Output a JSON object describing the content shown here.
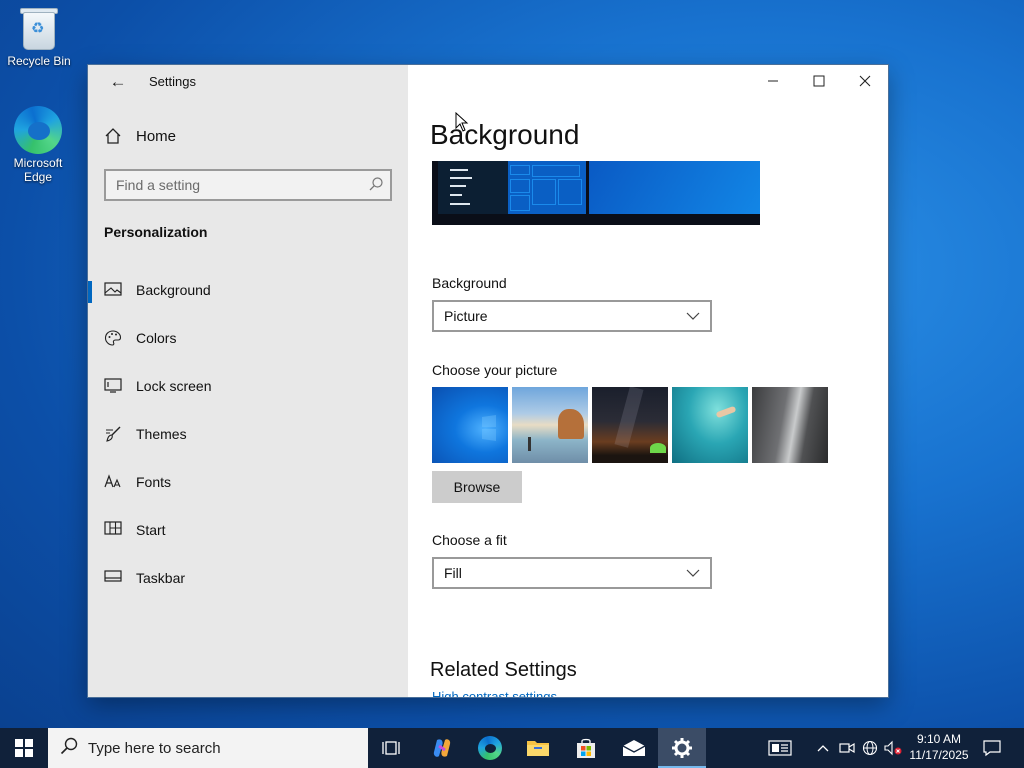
{
  "desktop": {
    "icons": [
      {
        "label": "Recycle Bin"
      },
      {
        "label": "Microsoft Edge"
      }
    ]
  },
  "window": {
    "app_title": "Settings",
    "nav": {
      "home_label": "Home",
      "search_placeholder": "Find a setting",
      "section_title": "Personalization",
      "items": [
        {
          "label": "Background",
          "icon": "picture-icon",
          "active": true
        },
        {
          "label": "Colors",
          "icon": "palette-icon",
          "active": false
        },
        {
          "label": "Lock screen",
          "icon": "lock-screen-icon",
          "active": false
        },
        {
          "label": "Themes",
          "icon": "brush-icon",
          "active": false
        },
        {
          "label": "Fonts",
          "icon": "font-icon",
          "active": false
        },
        {
          "label": "Start",
          "icon": "start-tiles-icon",
          "active": false
        },
        {
          "label": "Taskbar",
          "icon": "taskbar-icon",
          "active": false
        }
      ]
    },
    "main": {
      "page_title": "Background",
      "background_label": "Background",
      "background_value": "Picture",
      "choose_picture_label": "Choose your picture",
      "thumbnails": [
        "windows-blue",
        "beach-rocks",
        "night-sky-tent",
        "underwater-swimmer",
        "waterfall-cliff"
      ],
      "browse_label": "Browse",
      "fit_label": "Choose a fit",
      "fit_value": "Fill",
      "related_title": "Related Settings",
      "related_link_cutoff": "High contrast settings"
    }
  },
  "taskbar": {
    "search_placeholder": "Type here to search",
    "pinned": [
      "task-view",
      "copilot",
      "edge",
      "file-explorer",
      "store",
      "mail",
      "settings"
    ],
    "active_app": "settings",
    "clock_time": "9:10 AM",
    "clock_date": "11/17/2025"
  },
  "colors": {
    "accent": "#0067c0",
    "nav_bg": "#e8e8e8",
    "taskbar_bg": "#10213a"
  }
}
